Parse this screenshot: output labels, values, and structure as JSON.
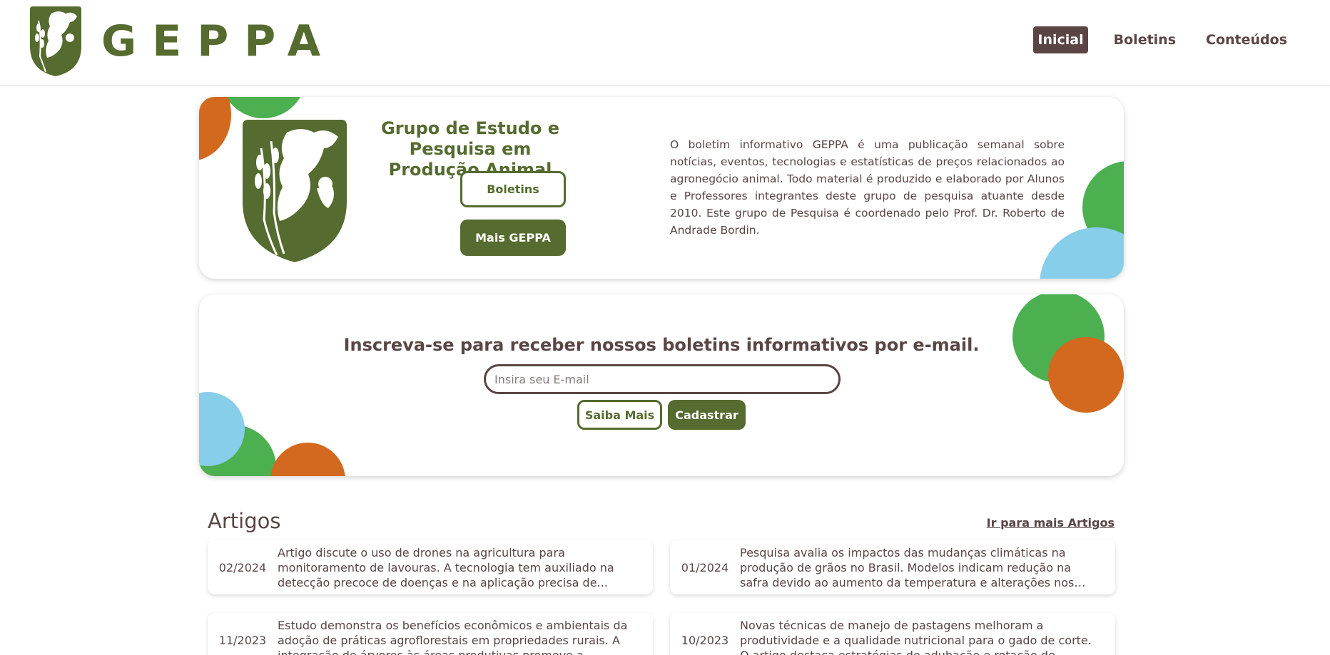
{
  "brand": {
    "name": "GEPPA"
  },
  "nav": [
    {
      "label": "Inicial",
      "active": true
    },
    {
      "label": "Boletins",
      "active": false
    },
    {
      "label": "Conteúdos",
      "active": false
    }
  ],
  "hero": {
    "title": "Grupo de Estudo e Pesquisa em Produção Animal",
    "boletins_button": "Boletins",
    "mais_button": "Mais GEPPA",
    "description": "O boletim informativo GEPPA é uma publicação semanal sobre notícias, eventos, tecnologias e estatísticas de preços relacionados ao agronegócio animal. Todo material é produzido e elaborado por Alunos e Professores integrantes deste grupo de pesquisa atuante desde 2010. Este grupo de Pesquisa é coordenado pelo Prof. Dr. Roberto de Andrade Bordin."
  },
  "subscribe": {
    "title": "Inscreva-se para receber nossos boletins informativos por e-mail.",
    "placeholder": "Insira seu E-mail",
    "saiba_button": "Saiba Mais",
    "cadastrar_button": "Cadastrar"
  },
  "articles": {
    "heading": "Artigos",
    "more_link": "Ir para mais Artigos",
    "items": [
      {
        "date": "02/2024",
        "text": "Artigo discute o uso de drones na agricultura para monitoramento de lavouras. A tecnologia tem auxiliado na detecção precoce de doenças e na aplicação precisa de..."
      },
      {
        "date": "01/2024",
        "text": "Pesquisa avalia os impactos das mudanças climáticas na produção de grãos no Brasil. Modelos indicam redução na safra devido ao aumento da temperatura e alterações nos regimes d..."
      },
      {
        "date": "11/2023",
        "text": "Estudo demonstra os benefícios econômicos e ambientais da adoção de práticas agroflorestais em propriedades rurais. A integração de árvores às áreas produtivas promove a..."
      },
      {
        "date": "10/2023",
        "text": "Novas técnicas de manejo de pastagens melhoram a produtividade e a qualidade nutricional para o gado de corte. O artigo destaca estratégias de adubação e rotação de..."
      }
    ]
  },
  "colors": {
    "brand_green": "#556b2f",
    "brown": "#5b4444",
    "accent_green": "#4caf50",
    "accent_orange": "#d2691e",
    "accent_blue": "#87ceeb"
  }
}
